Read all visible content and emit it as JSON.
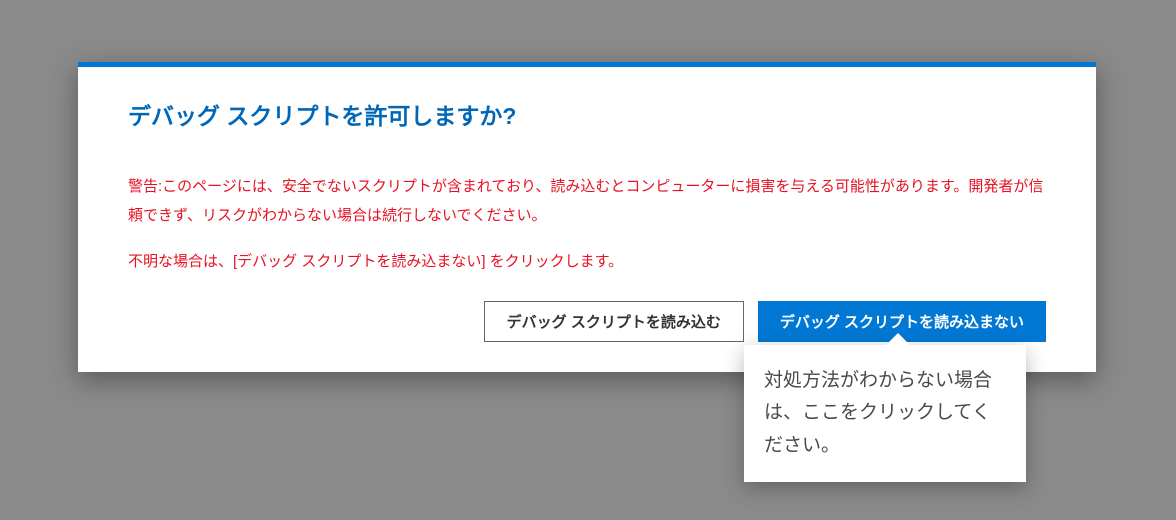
{
  "dialog": {
    "title": "デバッグ スクリプトを許可しますか?",
    "warning": "警告:このページには、安全でないスクリプトが含まれており、読み込むとコンピューターに損害を与える可能性があります。開発者が信頼できず、リスクがわからない場合は続行しないでください。",
    "instruction": "不明な場合は、[デバッグ スクリプトを読み込まない] をクリックします。",
    "buttons": {
      "load": "デバッグ スクリプトを読み込む",
      "dontLoad": "デバッグ スクリプトを読み込まない"
    }
  },
  "tooltip": {
    "text": "対処方法がわからない場合は、ここをクリックしてください。"
  }
}
